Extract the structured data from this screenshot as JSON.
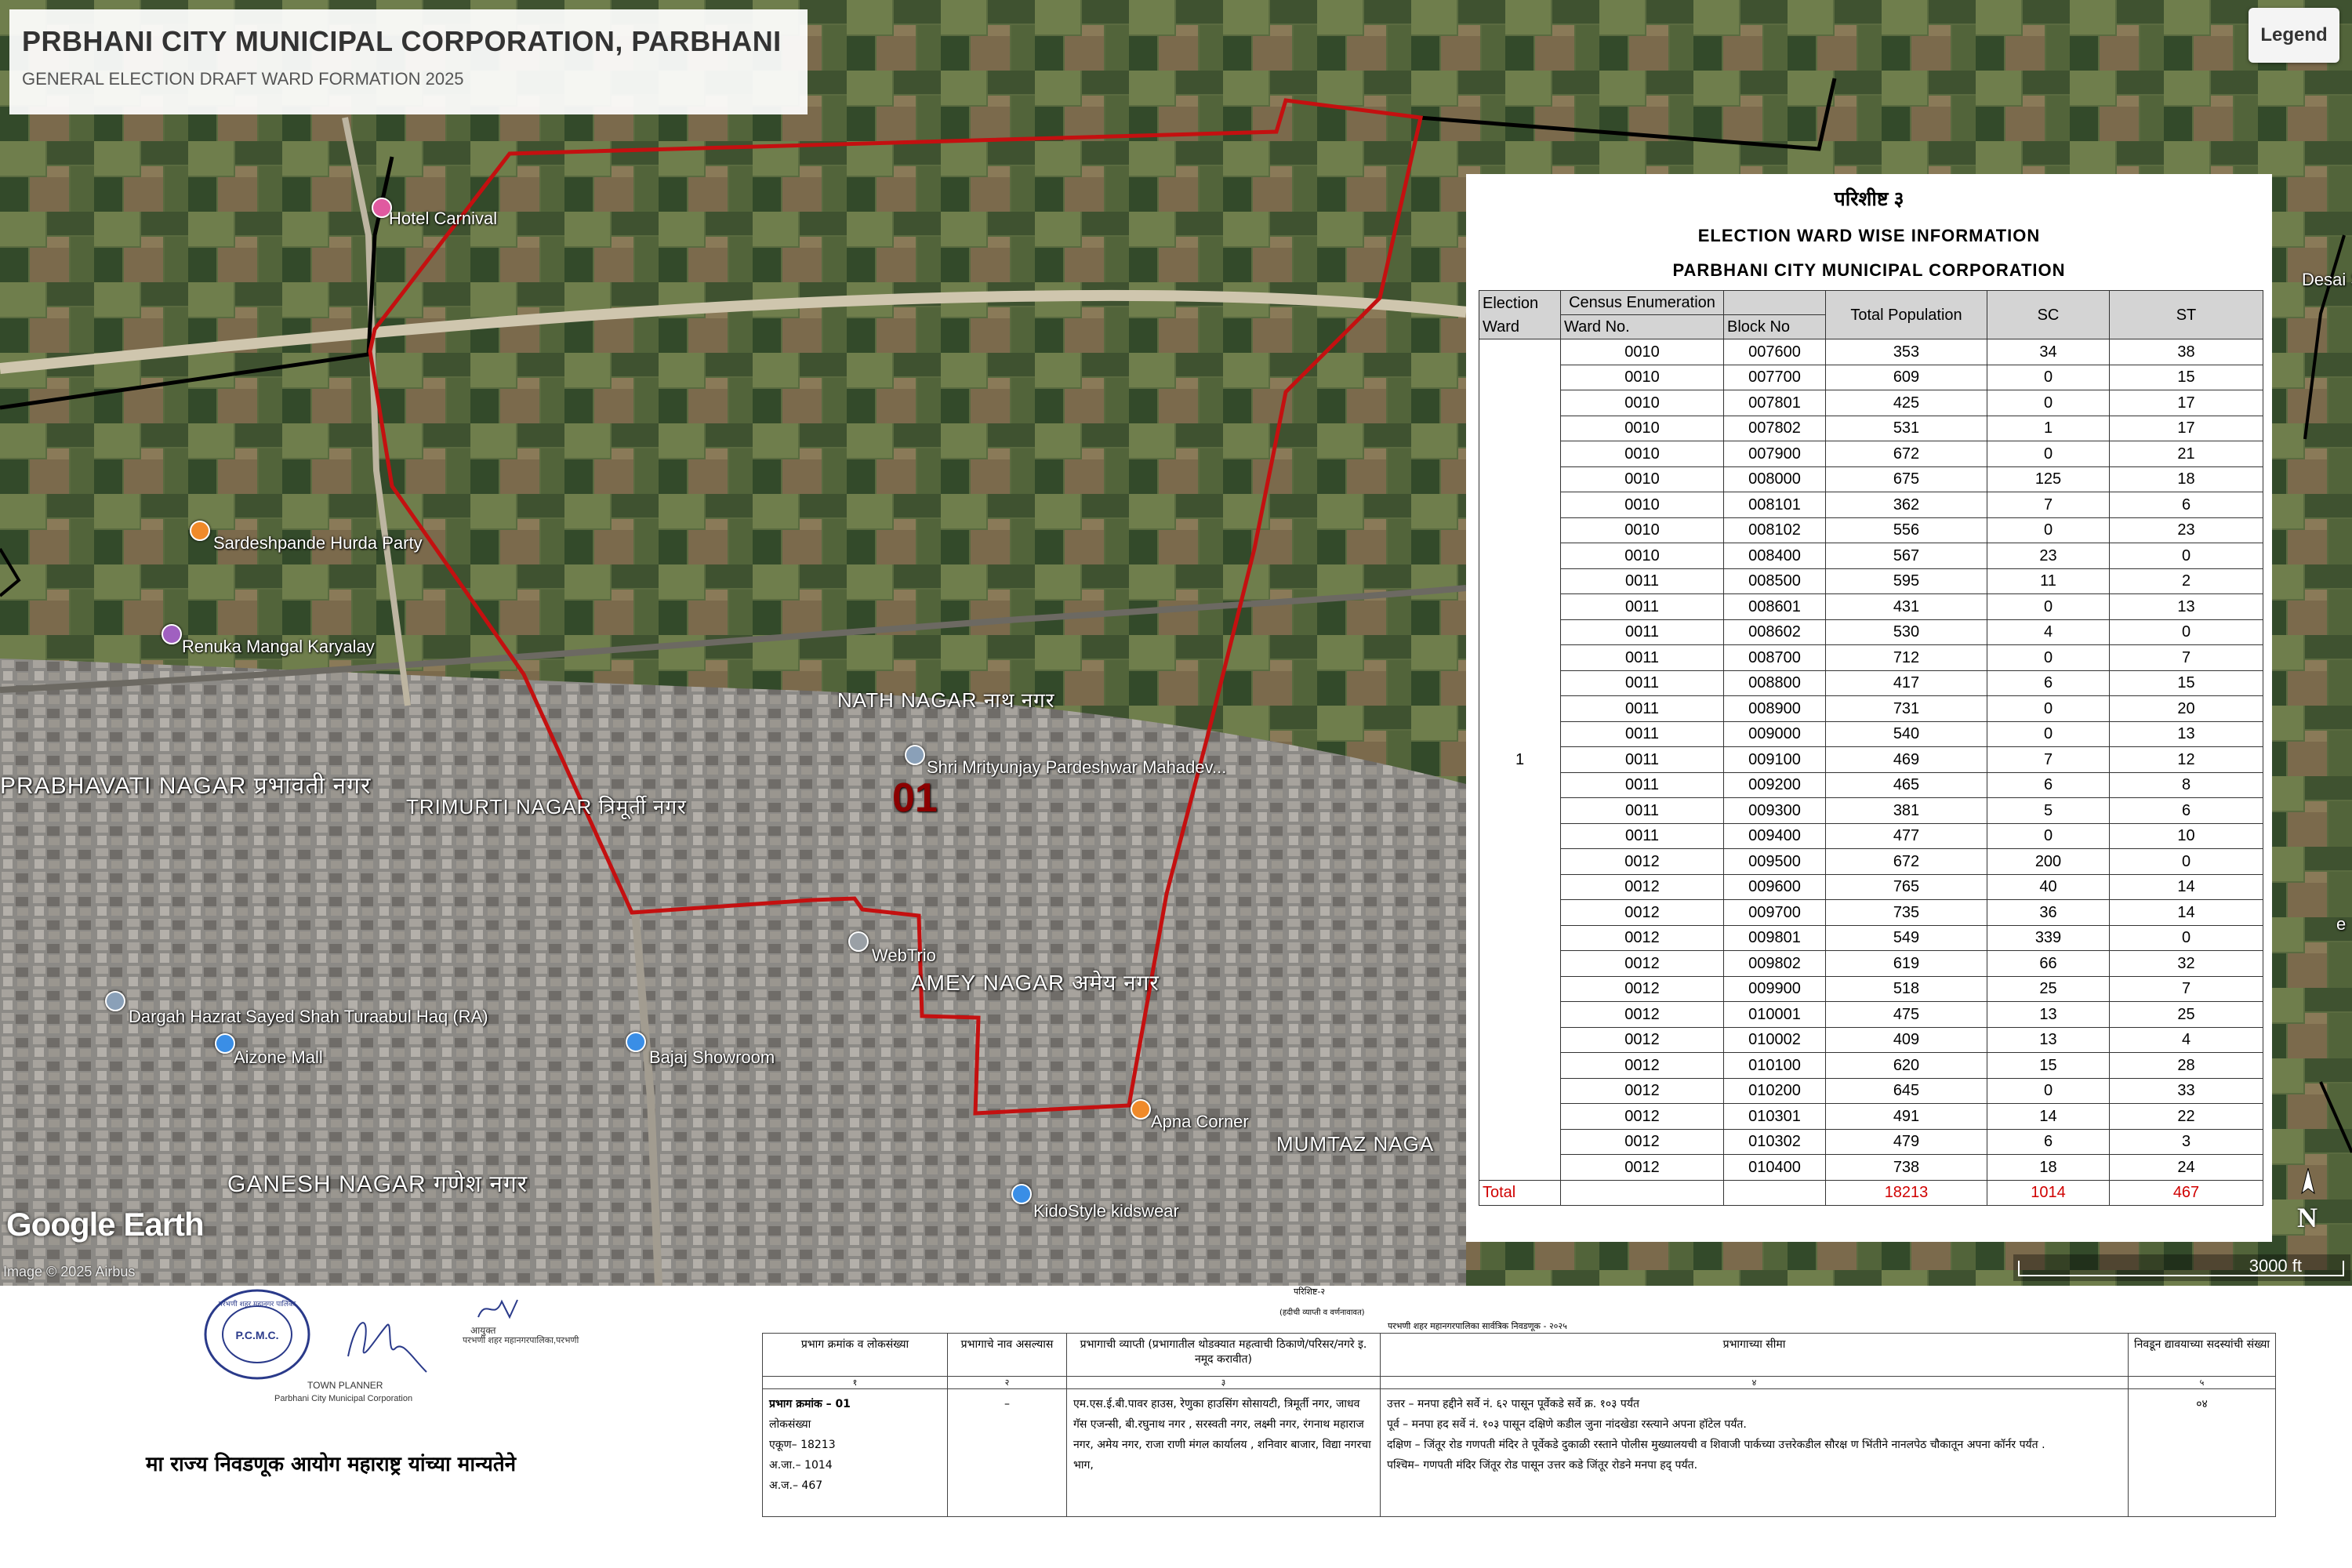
{
  "header": {
    "title": "PRBHANI CITY MUNICIPAL CORPORATION, PARBHANI",
    "subtitle": "GENERAL ELECTION DRAFT WARD FORMATION 2025"
  },
  "legend_button": "Legend",
  "map": {
    "ward_number": "01",
    "places": {
      "hotel_carnival": "Hotel Carnival",
      "sardeshpande": "Sardeshpande Hurda Party",
      "renuka": "Renuka Mangal Karyalay",
      "nath_nagar": "NATH NAGAR नाथ नगर",
      "shri_mrityunjay": "Shri Mrityunjay Pardeshwar Mahadev...",
      "prabhavati": "PRABHAVATI NAGAR प्रभावती नगर",
      "trimurti": "TRIMURTI NAGAR त्रिमूर्ती नगर",
      "webtrio": "WebTrio",
      "amey_nagar": "AMEY NAGAR अमेय नगर",
      "dargah": "Dargah Hazrat Sayed Shah Turaabul Haq (RA)",
      "aizone": "Aizone Mall",
      "bajaj": "Bajaj Showroom",
      "apna_corner": "Apna Corner",
      "mumtaz": "MUMTAZ NAGA",
      "ganesh": "GANESH NAGAR गणेश नगर",
      "kidostyle": "KidoStyle kidswear",
      "desai": "Desai Sale",
      "edge_e": "e"
    },
    "google_earth": "Google Earth",
    "image_credit": "Image © 2025 Airbus",
    "scale": "3000 ft",
    "north": "N",
    "colors": {
      "ward_boundary": "#c41010",
      "admin_boundary": "#000000"
    }
  },
  "info_table": {
    "heading": "परिशीष्ट ३",
    "title": "ELECTION WARD  WISE INFORMATION",
    "subtitle": "PARBHANI CITY MUNICIPAL CORPORATION",
    "columns": {
      "election_ward": "Election Ward",
      "census": "Census Enumeration",
      "ward_no": "Ward No.",
      "block_no": "Block No",
      "total_population": "Total Population",
      "sc": "SC",
      "st": "ST"
    },
    "election_ward_value": "1",
    "rows": [
      [
        "0010",
        "007600",
        "353",
        "34",
        "38"
      ],
      [
        "0010",
        "007700",
        "609",
        "0",
        "15"
      ],
      [
        "0010",
        "007801",
        "425",
        "0",
        "17"
      ],
      [
        "0010",
        "007802",
        "531",
        "1",
        "17"
      ],
      [
        "0010",
        "007900",
        "672",
        "0",
        "21"
      ],
      [
        "0010",
        "008000",
        "675",
        "125",
        "18"
      ],
      [
        "0010",
        "008101",
        "362",
        "7",
        "6"
      ],
      [
        "0010",
        "008102",
        "556",
        "0",
        "23"
      ],
      [
        "0010",
        "008400",
        "567",
        "23",
        "0"
      ],
      [
        "0011",
        "008500",
        "595",
        "11",
        "2"
      ],
      [
        "0011",
        "008601",
        "431",
        "0",
        "13"
      ],
      [
        "0011",
        "008602",
        "530",
        "4",
        "0"
      ],
      [
        "0011",
        "008700",
        "712",
        "0",
        "7"
      ],
      [
        "0011",
        "008800",
        "417",
        "6",
        "15"
      ],
      [
        "0011",
        "008900",
        "731",
        "0",
        "20"
      ],
      [
        "0011",
        "009000",
        "540",
        "0",
        "13"
      ],
      [
        "0011",
        "009100",
        "469",
        "7",
        "12"
      ],
      [
        "0011",
        "009200",
        "465",
        "6",
        "8"
      ],
      [
        "0011",
        "009300",
        "381",
        "5",
        "6"
      ],
      [
        "0011",
        "009400",
        "477",
        "0",
        "10"
      ],
      [
        "0012",
        "009500",
        "672",
        "200",
        "0"
      ],
      [
        "0012",
        "009600",
        "765",
        "40",
        "14"
      ],
      [
        "0012",
        "009700",
        "735",
        "36",
        "14"
      ],
      [
        "0012",
        "009801",
        "549",
        "339",
        "0"
      ],
      [
        "0012",
        "009802",
        "619",
        "66",
        "32"
      ],
      [
        "0012",
        "009900",
        "518",
        "25",
        "7"
      ],
      [
        "0012",
        "010001",
        "475",
        "13",
        "25"
      ],
      [
        "0012",
        "010002",
        "409",
        "13",
        "4"
      ],
      [
        "0012",
        "010100",
        "620",
        "15",
        "28"
      ],
      [
        "0012",
        "010200",
        "645",
        "0",
        "33"
      ],
      [
        "0012",
        "010301",
        "491",
        "14",
        "22"
      ],
      [
        "0012",
        "010302",
        "479",
        "6",
        "3"
      ],
      [
        "0012",
        "010400",
        "738",
        "18",
        "24"
      ]
    ],
    "total": {
      "label": "Total",
      "population": "18213",
      "sc": "1014",
      "st": "467"
    }
  },
  "signatures": {
    "seal_top": "परभणी शहर महानगर पालिका",
    "seal_center": "P.C.M.C.",
    "town_planner": "TOWN PLANNER",
    "town_planner_org": "Parbhani City Municipal Corporation",
    "commissioner_title": "आयुक्त",
    "commissioner_org": "परभणी शहर महानगरपालिका,परभणी",
    "approval": "मा राज्य निवडणूक आयोग महाराष्ट्र यांच्या मान्यतेने"
  },
  "schedule": {
    "head1": "परिशिष्ट-२",
    "head2": "(हदीची व्याप्ती व वर्णनावावत)",
    "head3": "परभणी शहर महानगरपालिका सार्वत्रिक निवडणूक - २०२५",
    "col_headers": [
      "प्रभाग क्रमांक व लोकसंख्या",
      "प्रभागाचे नाव असल्यास",
      "प्रभागाची व्याप्ती (प्रभागातील थोडक्यात महत्वाची ठिकाणे/परिसर/नगरे इ. नमूद करावीत)",
      "प्रभागाच्या सीमा",
      "निवडून द्यावयाच्या सदस्यांची संख्या"
    ],
    "col_numbers": [
      "१",
      "२",
      "३",
      "४",
      "५"
    ],
    "ward_info": [
      "प्रभाग क्रमांक – 01",
      "लोकसंख्या",
      "एकूण–   18213",
      "अ.जा.–  1014",
      "अ.ज.– 467"
    ],
    "ward_name": "–",
    "extent": "एम.एस.ई.बी.पावर हाउस, रेणुका हाउसिंग सोसायटी, त्रिमूर्ती नगर, जाधव गॅस एजन्सी, बी.रघुनाथ नगर , सरस्वती नगर, लक्ष्मी नगर, रंगनाथ महाराज नगर, अमेय नगर, राजा राणी मंगल कार्यालय , शनिवार बाजार, विद्या नगरचा भाग,",
    "boundaries": [
      "उत्तर  –  मनपा हद्दीने सर्वे नं. ६२ पासून पूर्वेकडे सर्वे क्र. १०३ पर्यंत",
      "पूर्व   –  मनपा हद सर्वे नं. १०३ पासून दक्षिणे कडील जुना नांदखेडा रस्त्याने अपना हॉटेल पर्यंत.",
      "दक्षिण – जिंतूर रोड गणपती मंदिर ते पूर्वेकडे दुकाळी रस्ताने पोलीस मुख्यालयची व शिवाजी पार्कच्या उत्तरेकडील सौरक्ष ण भिंतीने नानलपेठ चौकातून अपना कॉर्नर पर्यंत .",
      "पश्चिम– गणपती मंदिर जिंतूर रोड पासून उत्तर कडे जिंतूर रोडने मनपा हद् पर्यंत."
    ],
    "members": "०४"
  }
}
